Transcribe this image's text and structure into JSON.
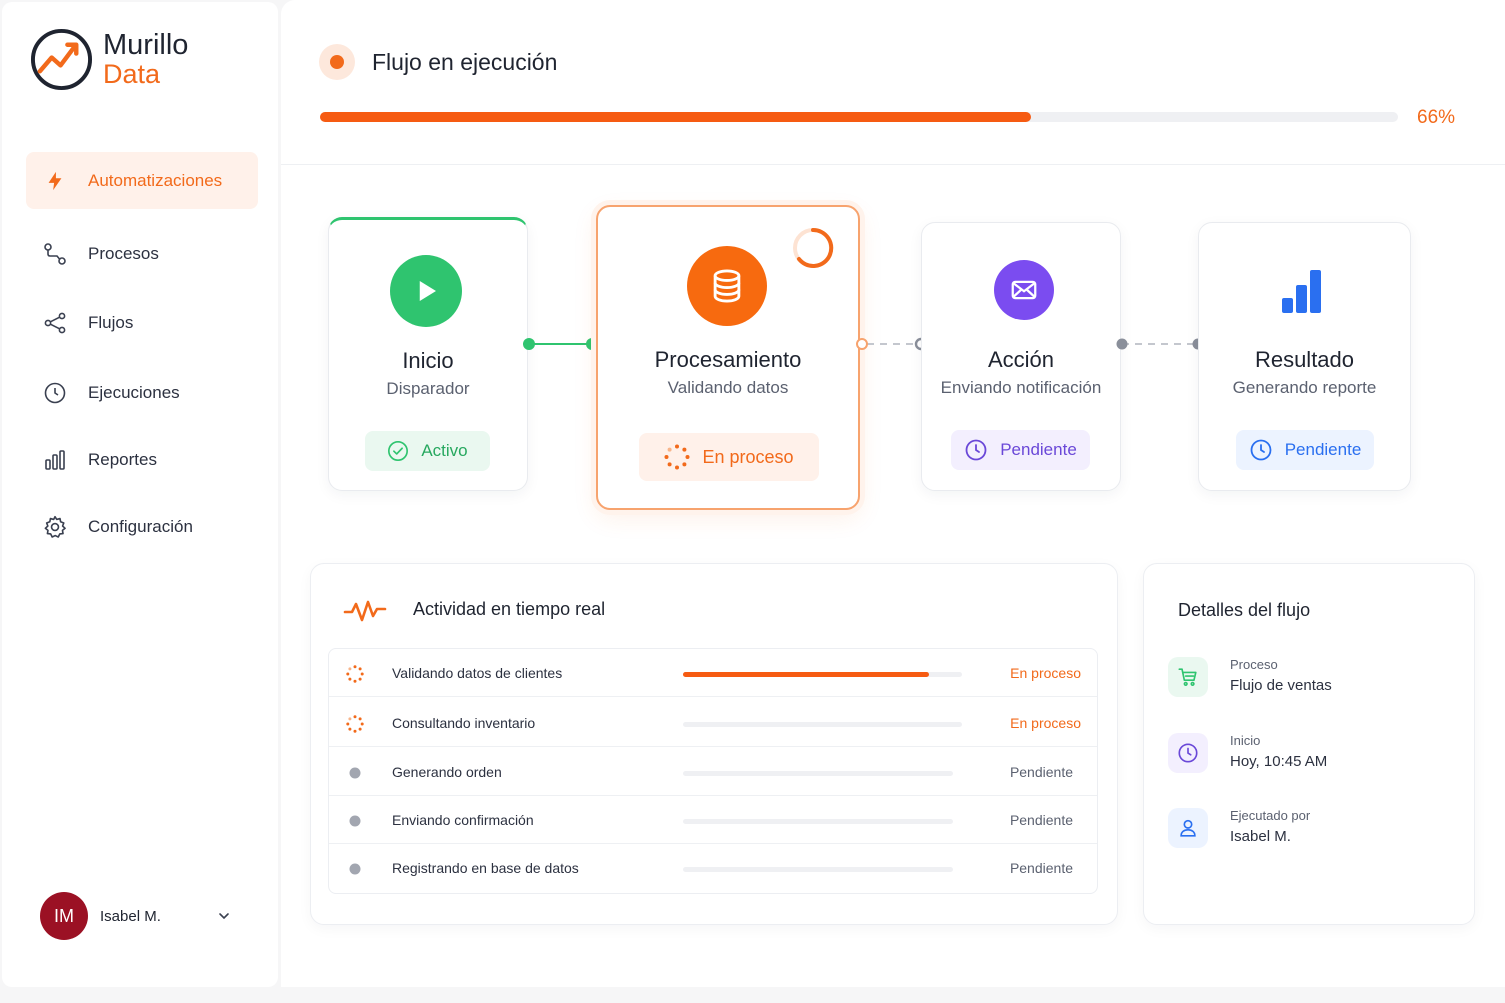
{
  "brand": {
    "line1": "Murillo",
    "line2": "Data",
    "accent": "#f26a1b"
  },
  "sidebar": {
    "items": [
      {
        "label": "Automatizaciones",
        "icon": "bolt-icon",
        "active": true
      },
      {
        "label": "Procesos",
        "icon": "process-icon",
        "active": false
      },
      {
        "label": "Flujos",
        "icon": "share-nodes-icon",
        "active": false
      },
      {
        "label": "Ejecuciones",
        "icon": "clock-icon",
        "active": false
      },
      {
        "label": "Reportes",
        "icon": "bar-chart-icon",
        "active": false
      },
      {
        "label": "Configuración",
        "icon": "gear-icon",
        "active": false
      }
    ],
    "user": {
      "initials": "IM",
      "name": "Isabel M."
    }
  },
  "header": {
    "title": "Flujo en ejecución",
    "progress": 66,
    "progress_label": "66%"
  },
  "steps": [
    {
      "title": "Inicio",
      "subtitle": "Disparador",
      "status": "Activo",
      "icon": "play-icon",
      "color": "#2fc46f"
    },
    {
      "title": "Procesamiento",
      "subtitle": "Validando datos",
      "status": "En proceso",
      "icon": "database-icon",
      "color": "#f76a0f"
    },
    {
      "title": "Acción",
      "subtitle": "Enviando notificación",
      "status": "Pendiente",
      "icon": "envelope-icon",
      "color": "#7b4cf0"
    },
    {
      "title": "Resultado",
      "subtitle": "Generando reporte",
      "status": "Pendiente",
      "icon": "bar-chart-icon",
      "color": "#2a6ff0"
    }
  ],
  "activity": {
    "title": "Actividad en tiempo real",
    "rows": [
      {
        "text": "Validando datos de clientes",
        "status": "En proceso",
        "progress": 0.88,
        "state": "running"
      },
      {
        "text": "Consultando inventario",
        "status": "En proceso",
        "progress": 0,
        "state": "running"
      },
      {
        "text": "Generando orden",
        "status": "Pendiente",
        "progress": 0,
        "state": "pending"
      },
      {
        "text": "Enviando confirmación",
        "status": "Pendiente",
        "progress": 0,
        "state": "pending"
      },
      {
        "text": "Registrando en base de datos",
        "status": "Pendiente",
        "progress": 0,
        "state": "pending"
      }
    ]
  },
  "details": {
    "title": "Detalles del flujo",
    "items": [
      {
        "label": "Proceso",
        "value": "Flujo de ventas",
        "icon": "cart-icon"
      },
      {
        "label": "Inicio",
        "value": "Hoy, 10:45 AM",
        "icon": "clock-icon"
      },
      {
        "label": "Ejecutado por",
        "value": "Isabel M.",
        "icon": "user-icon"
      }
    ]
  }
}
